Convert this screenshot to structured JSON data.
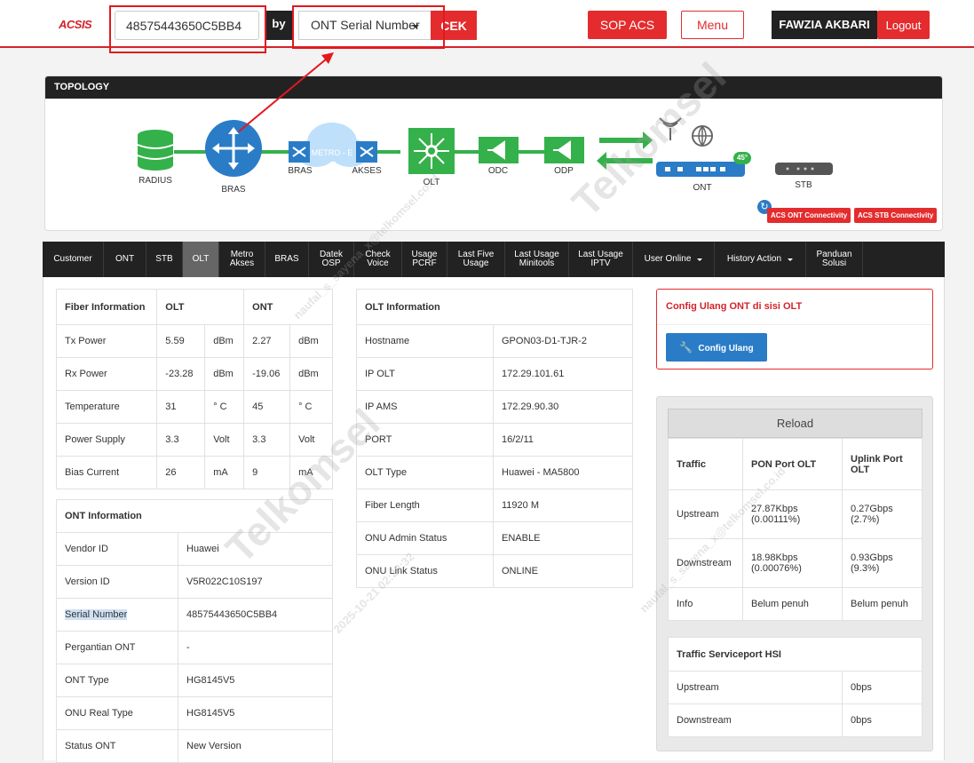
{
  "header": {
    "logo": "ACSIS",
    "search_value": "48575443650C5BB4",
    "by_label": "by",
    "search_by": "ONT Serial Number",
    "check_label": "CEK",
    "sop_label": "SOP ACS",
    "menu_label": "Menu",
    "user_name": "FAWZIA AKBARI",
    "logout_label": "Logout"
  },
  "topology": {
    "title": "TOPOLOGY",
    "nodes": [
      "RADIUS",
      "BRAS",
      "BRAS",
      "METRO - E",
      "AKSES",
      "OLT",
      "ODC",
      "ODP",
      "ONT",
      "STB"
    ],
    "rx_level_badge": "45°",
    "acs_ont_label": "ACS ONT Connectivity",
    "acs_stb_label": "ACS STB Connectivity"
  },
  "tabs": [
    {
      "label": "Customer"
    },
    {
      "label": "ONT"
    },
    {
      "label": "STB"
    },
    {
      "label": "OLT",
      "active": true
    },
    {
      "label": "Metro\nAkses"
    },
    {
      "label": "BRAS"
    },
    {
      "label": "Datek\nOSP"
    },
    {
      "label": "Check\nVoice"
    },
    {
      "label": "Usage\nPCRF"
    },
    {
      "label": "Last Five\nUsage"
    },
    {
      "label": "Last Usage\nMinitools"
    },
    {
      "label": "Last Usage\nIPTV"
    },
    {
      "label": "User Online",
      "dropdown": true
    },
    {
      "label": "History Action",
      "dropdown": true
    },
    {
      "label": "Panduan\nSolusi"
    }
  ],
  "fiber": {
    "headers": [
      "Fiber Information",
      "OLT",
      "ONT"
    ],
    "rows": [
      [
        "Tx Power",
        "5.59",
        "dBm",
        "2.27",
        "dBm"
      ],
      [
        "Rx Power",
        "-23.28",
        "dBm",
        "-19.06",
        "dBm"
      ],
      [
        "Temperature",
        "31",
        "° C",
        "45",
        "° C"
      ],
      [
        "Power Supply",
        "3.3",
        "Volt",
        "3.3",
        "Volt"
      ],
      [
        "Bias Current",
        "26",
        "mA",
        "9",
        "mA"
      ]
    ]
  },
  "ont_info": {
    "title": "ONT Information",
    "rows": [
      [
        "Vendor ID",
        "Huawei"
      ],
      [
        "Version ID",
        "V5R022C10S197"
      ],
      [
        "Serial Number",
        "48575443650C5BB4"
      ],
      [
        "Pergantian ONT",
        "-"
      ],
      [
        "ONT Type",
        "HG8145V5"
      ],
      [
        "ONU Real Type",
        "HG8145V5"
      ],
      [
        "Status ONT",
        "New Version"
      ]
    ]
  },
  "olt_info": {
    "title": "OLT Information",
    "rows": [
      [
        "Hostname",
        "GPON03-D1-TJR-2"
      ],
      [
        "IP OLT",
        "172.29.101.61"
      ],
      [
        "IP AMS",
        "172.29.90.30"
      ],
      [
        "PORT",
        "16/2/11"
      ],
      [
        "OLT Type",
        "Huawei - MA5800"
      ],
      [
        "Fiber Length",
        "11920 M"
      ],
      [
        "ONU Admin Status",
        "ENABLE"
      ],
      [
        "ONU Link Status",
        "ONLINE"
      ]
    ]
  },
  "config": {
    "title": "Config Ulang ONT di sisi OLT",
    "button_label": "Config Ulang"
  },
  "traffic": {
    "reload_label": "Reload",
    "headers": [
      "Traffic",
      "PON Port OLT",
      "Uplink Port OLT"
    ],
    "rows": [
      [
        "Upstream",
        "27.87Kbps (0.00111%)",
        "0.27Gbps (2.7%)"
      ],
      [
        "Downstream",
        "18.98Kbps (0.00076%)",
        "0.93Gbps (9.3%)"
      ],
      [
        "Info",
        "Belum penuh",
        "Belum penuh"
      ]
    ]
  },
  "serviceport": {
    "title": "Traffic Serviceport HSI",
    "rows": [
      [
        "Upstream",
        "0bps"
      ],
      [
        "Downstream",
        "0bps"
      ]
    ]
  },
  "watermark": {
    "brand": "Telkomsel",
    "user": "naufal_s_sayena_x@telkomsel.co.id",
    "stamp": "2025-10-21 02:29:32"
  },
  "colors": {
    "accent_red": "#e42c2e",
    "dark": "#222222",
    "topology_green": "#35b14b",
    "topology_blue": "#2a7cc7"
  }
}
